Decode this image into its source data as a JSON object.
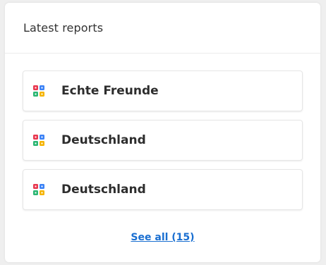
{
  "card": {
    "title": "Latest reports"
  },
  "reports": [
    {
      "label": "Echte Freunde",
      "icon": "dashboard-grid-icon"
    },
    {
      "label": "Deutschland",
      "icon": "dashboard-grid-icon"
    },
    {
      "label": "Deutschland",
      "icon": "dashboard-grid-icon"
    }
  ],
  "footer": {
    "see_all_label": "See all (15)"
  },
  "colors": {
    "link": "#1a6fd1",
    "icon_red": "#e8384f",
    "icon_blue": "#3b82f6",
    "icon_green": "#2bb673",
    "icon_yellow": "#f5b400"
  }
}
